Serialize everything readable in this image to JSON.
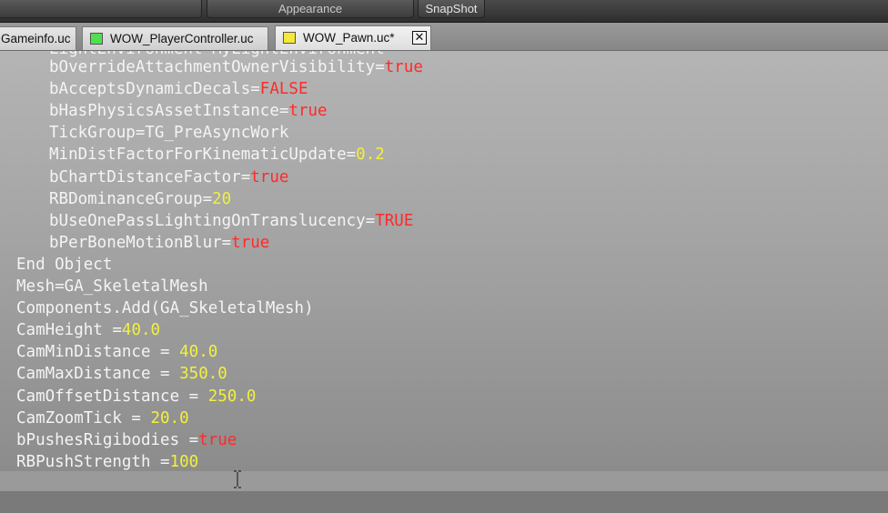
{
  "toolbar": {
    "left_button": "",
    "appearance_label": "Appearance",
    "snapshot_label": "SnapShot"
  },
  "tabs": [
    {
      "label": "Gameinfo.uc",
      "icon": "none"
    },
    {
      "label": "WOW_PlayerController.uc",
      "icon": "green-file-icon"
    },
    {
      "label": "WOW_Pawn.uc*",
      "icon": "yellow-file-icon",
      "active": true,
      "close": "✕"
    }
  ],
  "colors": {
    "text": "#f4f4f4",
    "number": "#f0f040",
    "keyword": "#ff2a2a",
    "green_icon": "#4ee04e",
    "yellow_icon": "#f4e93a"
  },
  "code": {
    "partial_line": "LightEnvironment=MyLightEnvironment",
    "lines": [
      {
        "key": "bOverrideAttachmentOwnerVisibility=",
        "value": "true",
        "type": "kw"
      },
      {
        "key": "bAcceptsDynamicDecals=",
        "value": "FALSE",
        "type": "kw"
      },
      {
        "key": "bHasPhysicsAssetInstance=",
        "value": "true",
        "type": "kw"
      },
      {
        "key": "TickGroup=TG_PreAsyncWork",
        "value": "",
        "type": ""
      },
      {
        "key": "MinDistFactorForKinematicUpdate=",
        "value": "0.2",
        "type": "val"
      },
      {
        "key": "bChartDistanceFactor=",
        "value": "true",
        "type": "kw"
      },
      {
        "key": "RBDominanceGroup=",
        "value": "20",
        "type": "val"
      },
      {
        "key": "bUseOnePassLightingOnTranslucency=",
        "value": "TRUE",
        "type": "kw"
      },
      {
        "key": "bPerBoneMotionBlur=",
        "value": "true",
        "type": "kw"
      },
      {
        "key": "End Object",
        "value": "",
        "type": ""
      },
      {
        "key": "Mesh=GA_SkeletalMesh",
        "value": "",
        "type": ""
      },
      {
        "key": "Components.Add(GA_SkeletalMesh)",
        "value": "",
        "type": ""
      },
      {
        "key": "CamHeight =",
        "value": "40.0",
        "type": "val"
      },
      {
        "key": "CamMinDistance = ",
        "value": "40.0",
        "type": "val"
      },
      {
        "key": "CamMaxDistance = ",
        "value": "350.0",
        "type": "val"
      },
      {
        "key": "CamOffsetDistance = ",
        "value": "250.0",
        "type": "val"
      },
      {
        "key": "CamZoomTick = ",
        "value": "20.0",
        "type": "val"
      },
      {
        "key": "bPushesRigibodies =",
        "value": "true",
        "type": "kw"
      },
      {
        "key": "RBPushStrength =",
        "value": "100",
        "type": "val"
      }
    ]
  }
}
